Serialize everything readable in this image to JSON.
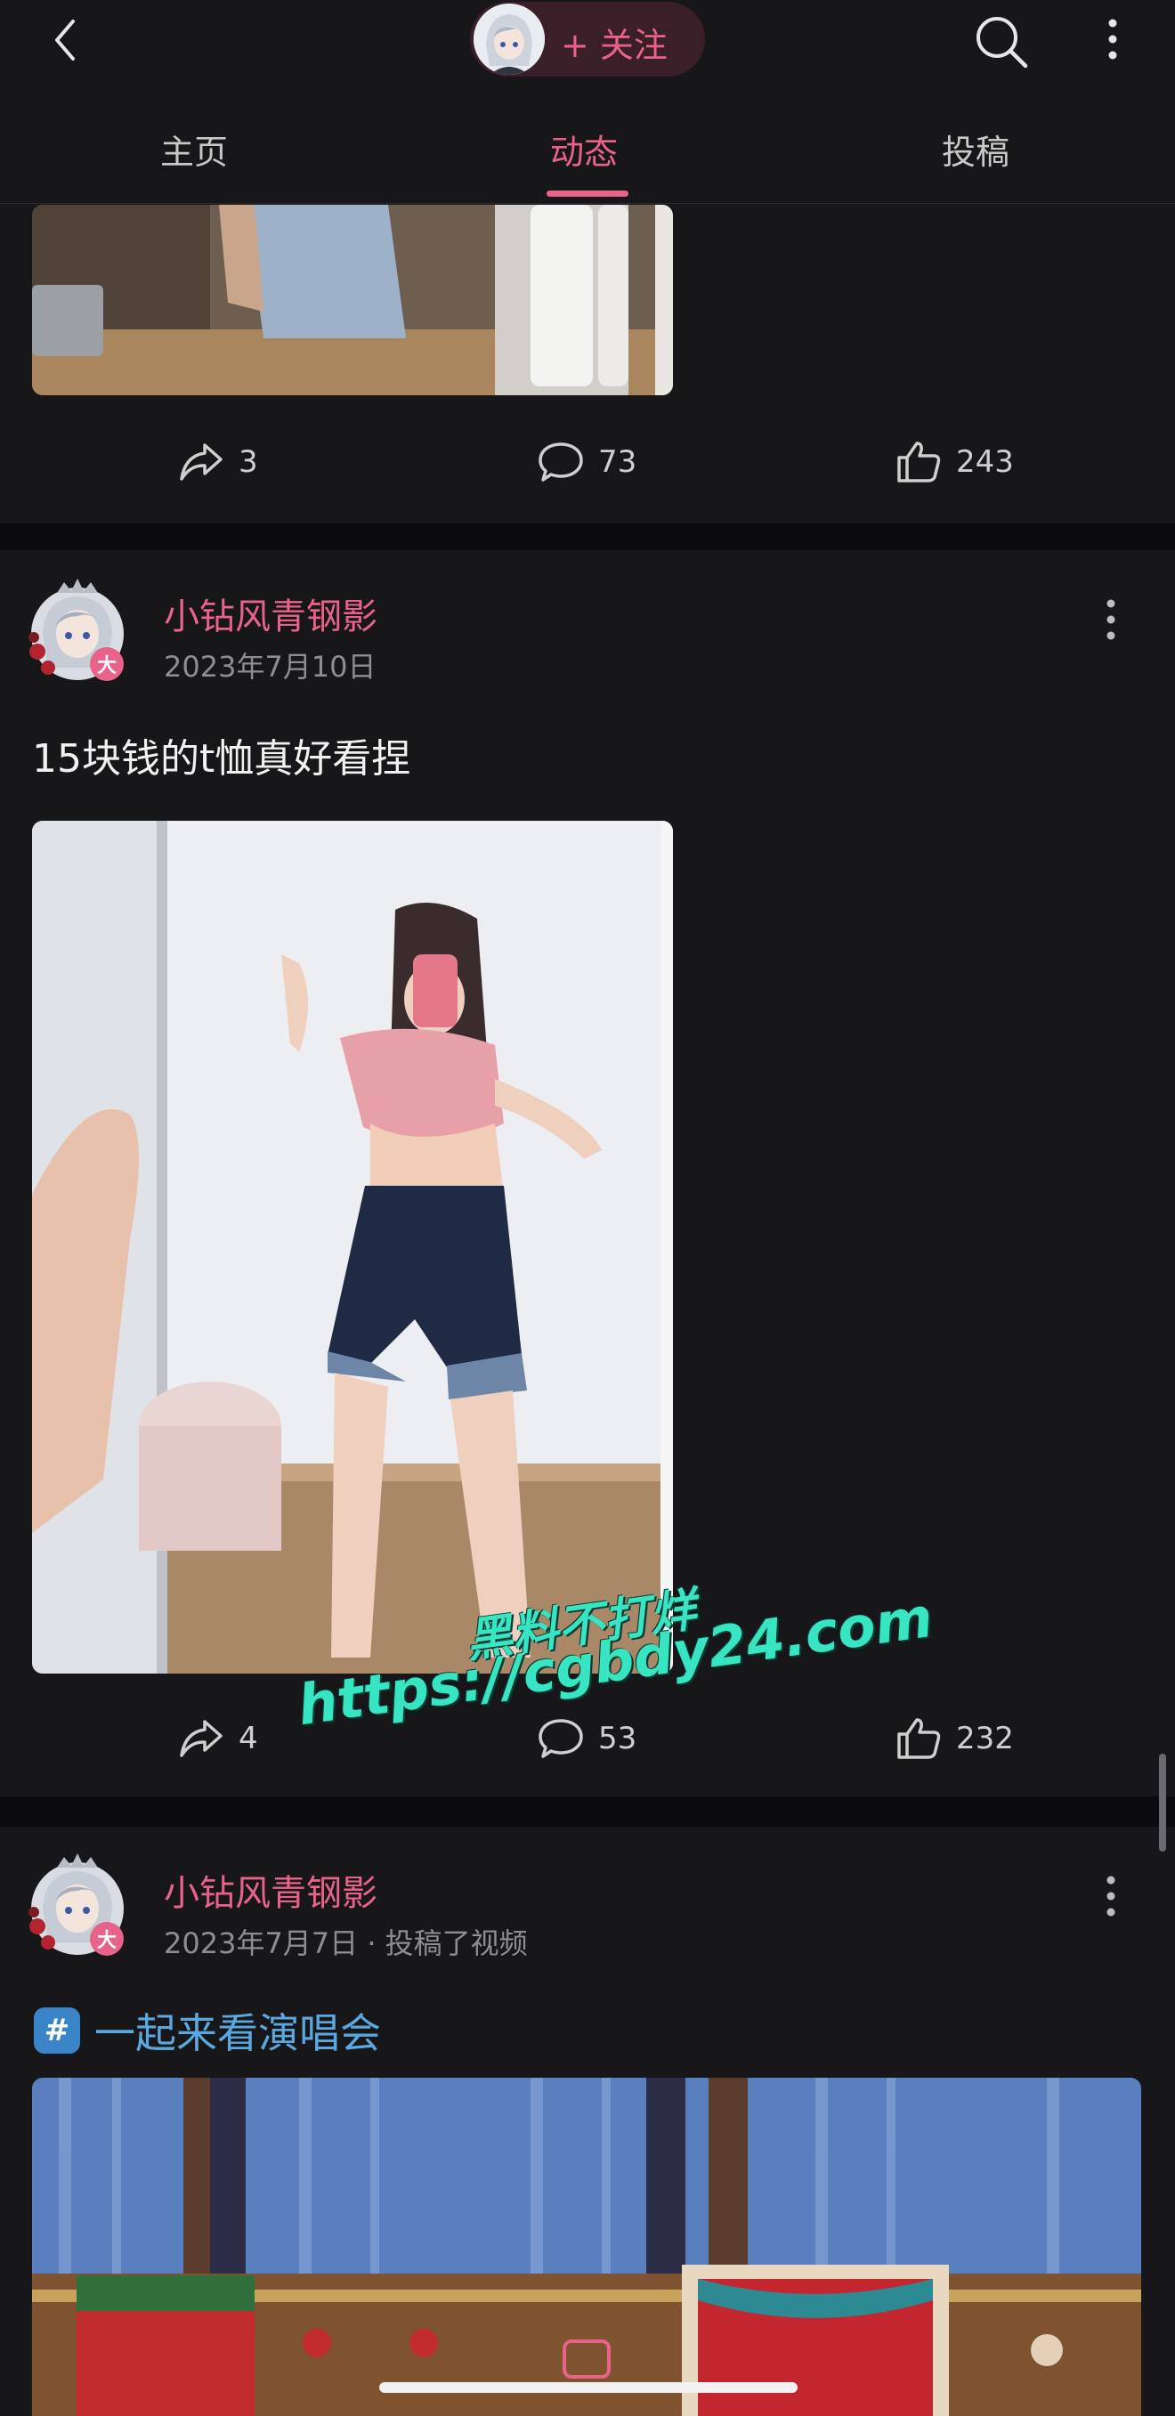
{
  "header": {
    "follow_label": "+ 关注"
  },
  "tabs": [
    {
      "label": "主页"
    },
    {
      "label": "动态"
    },
    {
      "label": "投稿"
    }
  ],
  "post0": {
    "share_count": "3",
    "comment_count": "73",
    "like_count": "243"
  },
  "post1": {
    "author": "小钻风青钢影",
    "badge": "大",
    "date": "2023年7月10日",
    "text": "15块钱的t恤真好看捏",
    "share_count": "4",
    "comment_count": "53",
    "like_count": "232"
  },
  "post2": {
    "author": "小钻风青钢影",
    "badge": "大",
    "date": "2023年7月7日 · 投稿了视频",
    "topic_icon": "#",
    "topic": "一起来看演唱会"
  },
  "watermark": {
    "line1": "黑料不打烊",
    "line2": "https://cgbdy24.com"
  },
  "colors": {
    "accent": "#e8628a",
    "background": "#17171a",
    "topic": "#5ba8e0",
    "watermark": "#38e5c2"
  }
}
